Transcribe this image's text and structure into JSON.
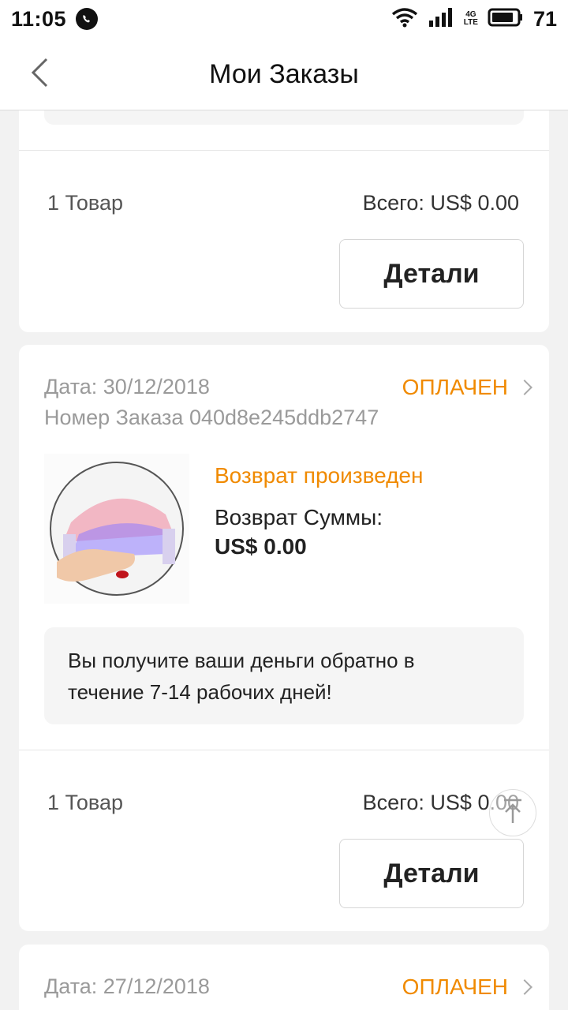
{
  "status_bar": {
    "time": "11:05",
    "network_label": "4G",
    "network_sub": "LTE",
    "battery": "71",
    "icons": [
      "whatsapp-icon",
      "wifi-icon",
      "signal-icon",
      "battery-icon"
    ]
  },
  "header": {
    "title": "Мои Заказы",
    "back_icon": "chevron-left-icon"
  },
  "orders": [
    {
      "items_count": "1 Товар",
      "total": "Всего: US$ 0.00",
      "details_label": "Детали"
    },
    {
      "date": "Дата: 30/12/2018",
      "status": "ОПЛАЧЕН",
      "order_number": "Номер Заказа 040d8e245ddb2747",
      "refund_status": "Возврат произведен",
      "refund_label": "Возврат Суммы:",
      "refund_amount": "US$ 0.00",
      "note": "Вы получите ваши деньги обратно в течение 7-14 рабочих дней!",
      "items_count": "1 Товар",
      "total": "Всего: US$ 0.00",
      "details_label": "Детали"
    },
    {
      "date": "Дата: 27/12/2018",
      "status": "ОПЛАЧЕН"
    }
  ],
  "colors": {
    "accent": "#f08a00",
    "background": "#f2f2f2",
    "card": "#ffffff",
    "muted_text": "#9a9a9a"
  }
}
